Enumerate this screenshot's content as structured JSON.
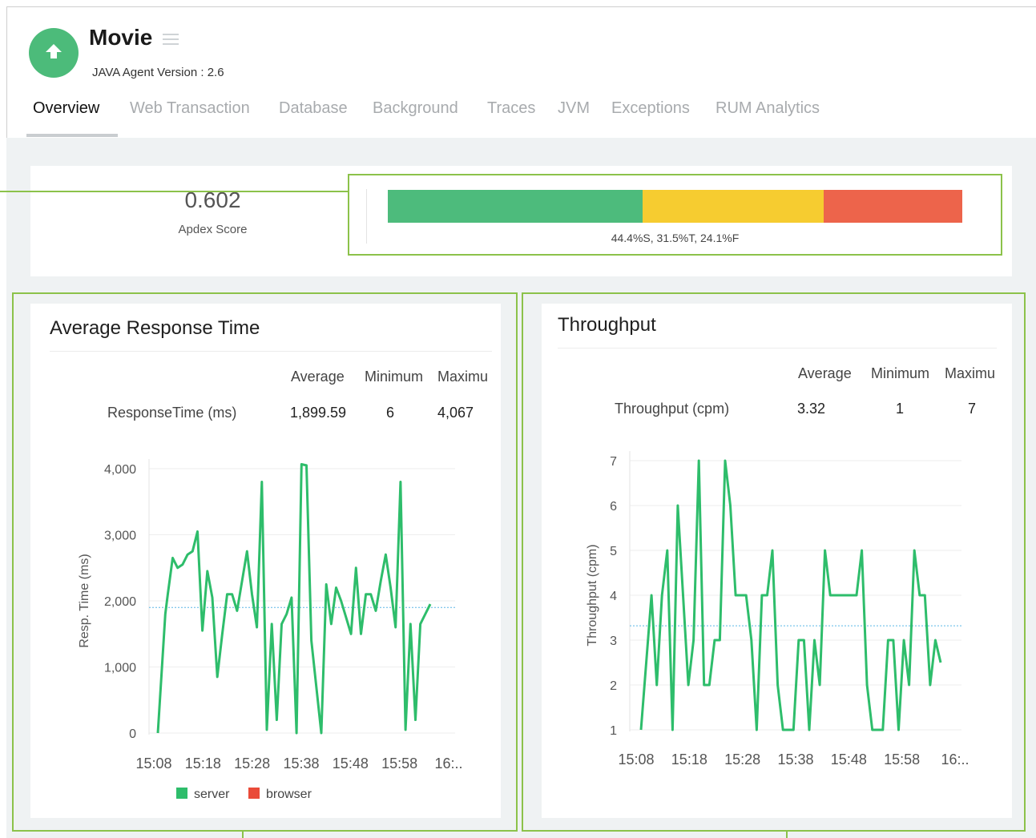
{
  "app": {
    "name": "Movie",
    "agent_version": "JAVA Agent Version : 2.6"
  },
  "tabs": [
    {
      "label": "Overview",
      "active": true
    },
    {
      "label": "Web Transaction",
      "active": false
    },
    {
      "label": "Database",
      "active": false
    },
    {
      "label": "Background",
      "active": false
    },
    {
      "label": "Traces",
      "active": false
    },
    {
      "label": "JVM",
      "active": false
    },
    {
      "label": "Exceptions",
      "active": false
    },
    {
      "label": "RUM Analytics",
      "active": false
    }
  ],
  "apdex": {
    "score": "0.602",
    "label": "Apdex Score",
    "summary": "44.4%S, 31.5%T, 24.1%F",
    "segments": [
      {
        "name": "S",
        "percent": 44.4,
        "color": "#4dbb7c"
      },
      {
        "name": "T",
        "percent": 31.5,
        "color": "#f6cc30"
      },
      {
        "name": "F",
        "percent": 24.1,
        "color": "#ed644b"
      }
    ]
  },
  "response_card": {
    "title": "Average Response Time",
    "headers": [
      "Average",
      "Minimum",
      "Maximu"
    ],
    "row_label": "ResponseTime (ms)",
    "values": [
      "1,899.59",
      "6",
      "4,067"
    ]
  },
  "throughput_card": {
    "title": "Throughput",
    "headers": [
      "Average",
      "Minimum",
      "Maximu"
    ],
    "row_label": "Throughput (cpm)",
    "values": [
      "3.32",
      "1",
      "7"
    ]
  },
  "legend": [
    {
      "label": "server",
      "color": "#2ebd6b"
    },
    {
      "label": "browser",
      "color": "#ea4b39"
    }
  ],
  "chart_data": [
    {
      "type": "line",
      "title": "Average Response Time",
      "ylabel": "Resp. Time (ms)",
      "xlabel": "",
      "ylim": [
        0,
        4000
      ],
      "yticks": [
        "0",
        "1,000",
        "2,000",
        "3,000",
        "4,000"
      ],
      "xticks": [
        "15:08",
        "15:18",
        "15:28",
        "15:38",
        "15:48",
        "15:58",
        "16:.."
      ],
      "average": 1899.59,
      "grid": true,
      "legend_position": "bottom",
      "series": [
        {
          "name": "server",
          "color": "#2ebd6b",
          "x": [
            0,
            1.5,
            2,
            3,
            4,
            5,
            6,
            7,
            8,
            9,
            10,
            11,
            12,
            13,
            14,
            15,
            16,
            17,
            18,
            19,
            20,
            21,
            22,
            23,
            24,
            25,
            26,
            27,
            28,
            29,
            30,
            31,
            32,
            33,
            34,
            35,
            36,
            37,
            38,
            39,
            40,
            41,
            42,
            43,
            44,
            45,
            46,
            47,
            48,
            49,
            50,
            51,
            52,
            53,
            54,
            55
          ],
          "y": [
            0,
            1800,
            2100,
            2650,
            2500,
            2550,
            2700,
            2750,
            3050,
            1550,
            2450,
            2050,
            850,
            1500,
            2100,
            2100,
            1850,
            2300,
            2750,
            2100,
            1600,
            3800,
            50,
            1650,
            200,
            1650,
            1800,
            2050,
            0,
            4067,
            4050,
            1400,
            700,
            0,
            2250,
            1650,
            2200,
            2000,
            1750,
            1500,
            2500,
            1500,
            2100,
            2100,
            1850,
            2300,
            2700,
            2200,
            1600,
            3800,
            50,
            1650,
            200,
            1650,
            1800,
            1950
          ]
        }
      ]
    },
    {
      "type": "line",
      "title": "Throughput",
      "ylabel": "Throughput (cpm)",
      "xlabel": "",
      "ylim": [
        1,
        7
      ],
      "yticks": [
        "1",
        "2",
        "3",
        "4",
        "5",
        "6",
        "7"
      ],
      "xticks": [
        "15:08",
        "15:18",
        "15:28",
        "15:38",
        "15:48",
        "15:58",
        "16:.."
      ],
      "average": 3.32,
      "grid": true,
      "series": [
        {
          "name": "server",
          "color": "#2ebd6b",
          "x": [
            0,
            2,
            3,
            4,
            5,
            6,
            7,
            8,
            9,
            10,
            11,
            12,
            13,
            14,
            15,
            16,
            17,
            18,
            19,
            20,
            21,
            22,
            23,
            24,
            25,
            26,
            27,
            28,
            29,
            30,
            31,
            32,
            33,
            34,
            35,
            36,
            37,
            38,
            39,
            40,
            41,
            42,
            43,
            44,
            45,
            46,
            47,
            48,
            49,
            50,
            51,
            52,
            53,
            54,
            55,
            56,
            57
          ],
          "y": [
            1,
            4,
            2,
            4,
            5,
            1,
            6,
            4,
            2,
            3,
            7,
            2,
            2,
            3,
            3,
            7,
            6,
            4,
            4,
            4,
            3,
            1,
            4,
            4,
            5,
            2,
            1,
            1,
            1,
            3,
            3,
            1,
            3,
            2,
            5,
            4,
            4,
            4,
            4,
            4,
            4,
            5,
            2,
            1,
            1,
            1,
            3,
            3,
            1,
            3,
            2,
            5,
            4,
            4,
            2,
            3,
            2.5
          ]
        }
      ]
    }
  ]
}
